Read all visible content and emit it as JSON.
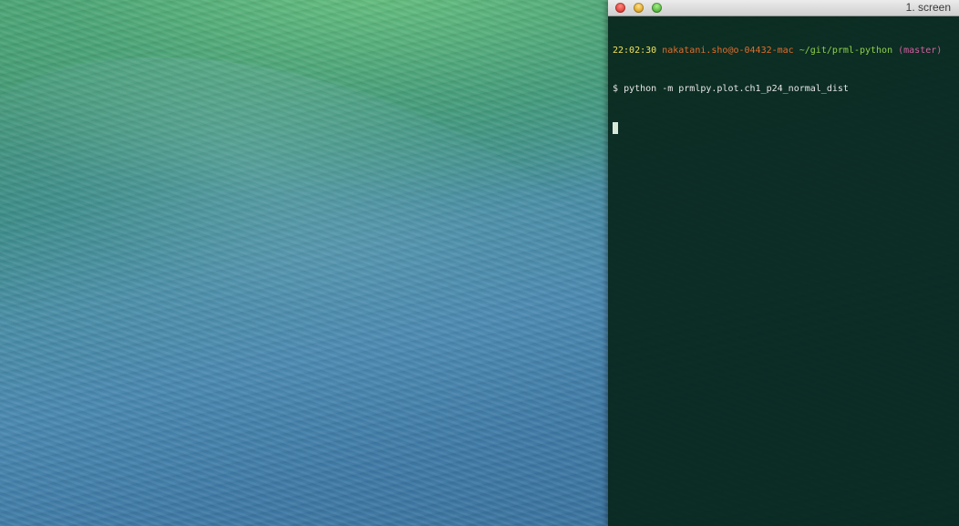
{
  "terminal": {
    "window_title": "1. screen",
    "prompt_line": {
      "time": "22:02:30",
      "user_host": "nakatani.sho@o-04432-mac",
      "path": "~/git/prml-python",
      "branch": "(master)"
    },
    "command_line": {
      "prompt_symbol": "$",
      "command": "python -m prmlpy.plot.ch1_p24_normal_dist"
    }
  },
  "colors": {
    "time": "#f1e05a",
    "user_host": "#e36d2c",
    "path": "#8fcf4a",
    "branch": "#d45fa0",
    "terminal_bg": "#08261c"
  }
}
